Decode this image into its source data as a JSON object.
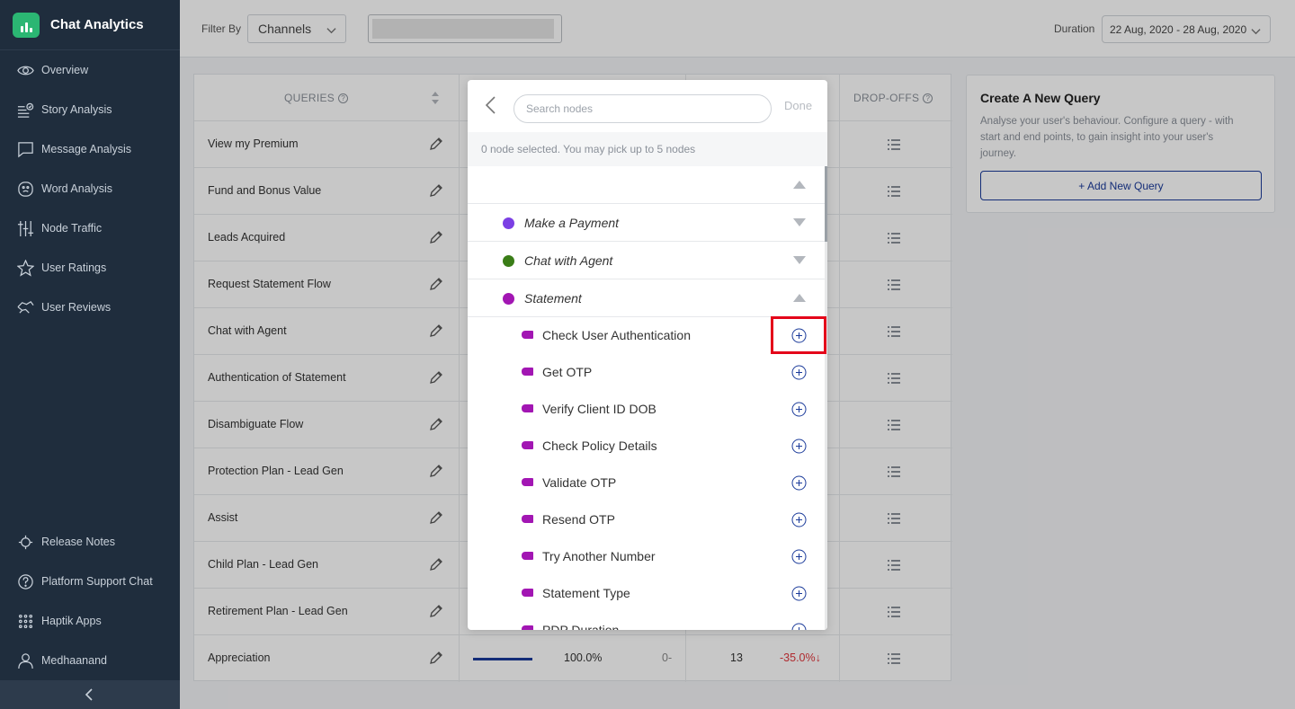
{
  "app": {
    "title": "Chat Analytics"
  },
  "sidebar": {
    "items": [
      {
        "label": "Overview",
        "icon": "eye-icon"
      },
      {
        "label": "Story Analysis",
        "icon": "list-check-icon"
      },
      {
        "label": "Message Analysis",
        "icon": "message-icon"
      },
      {
        "label": "Word Analysis",
        "icon": "face-icon"
      },
      {
        "label": "Node Traffic",
        "icon": "traffic-icon"
      },
      {
        "label": "User Ratings",
        "icon": "star-icon"
      },
      {
        "label": "User Reviews",
        "icon": "review-icon"
      }
    ],
    "bottom_items": [
      {
        "label": "Release Notes",
        "icon": "rocket-icon"
      },
      {
        "label": "Platform Support Chat",
        "icon": "help-icon"
      },
      {
        "label": "Haptik Apps",
        "icon": "grid-icon"
      },
      {
        "label": "Medhaanand",
        "icon": "user-icon"
      }
    ]
  },
  "topbar": {
    "filter_label": "Filter By",
    "channel_value": "Channels",
    "filter_input_value": "",
    "duration_label": "Duration",
    "duration_value": "22 Aug, 2020 - 28 Aug, 2020"
  },
  "table": {
    "col_queries": "QUERIES",
    "col_dropoffs": "DROP-OFFS",
    "rows": [
      "View my Premium",
      "Fund and Bonus Value",
      "Leads Acquired",
      "Request Statement Flow",
      "Chat with Agent",
      "Authentication of Statement",
      "Disambiguate Flow",
      "Protection Plan - Lead Gen",
      "Assist",
      "Child Plan - Lead Gen",
      "Retirement Plan - Lead Gen",
      "Appreciation"
    ],
    "last_row": {
      "percent": "100.0%",
      "zero": "0-",
      "count": "13",
      "delta": "-35.0%↓",
      "bar_fraction": 1.0
    }
  },
  "new_query": {
    "title": "Create A New Query",
    "description": "Analyse your user's behaviour. Configure a query - with start and end points, to gain insight into your user's journey.",
    "button": "+ Add New Query"
  },
  "modal": {
    "search_placeholder": "Search nodes",
    "search_value": "",
    "done_label": "Done",
    "info": "0 node selected. You may pick up to 5 nodes",
    "groups": [
      {
        "name": "",
        "expanded": true
      },
      {
        "name": "Make a Payment",
        "color": "#7b3fe4",
        "expanded": false
      },
      {
        "name": "Chat with Agent",
        "color": "#3a7d17",
        "expanded": false
      },
      {
        "name": "Statement",
        "color": "#a216b3",
        "expanded": true
      }
    ],
    "nodes": [
      "Check User Authentication",
      "Get OTP",
      "Verify Client ID DOB",
      "Check Policy Details",
      "Validate OTP",
      "Resend OTP",
      "Try Another Number",
      "Statement Type",
      "PDP Duration"
    ],
    "node_color": "#a216b3"
  }
}
